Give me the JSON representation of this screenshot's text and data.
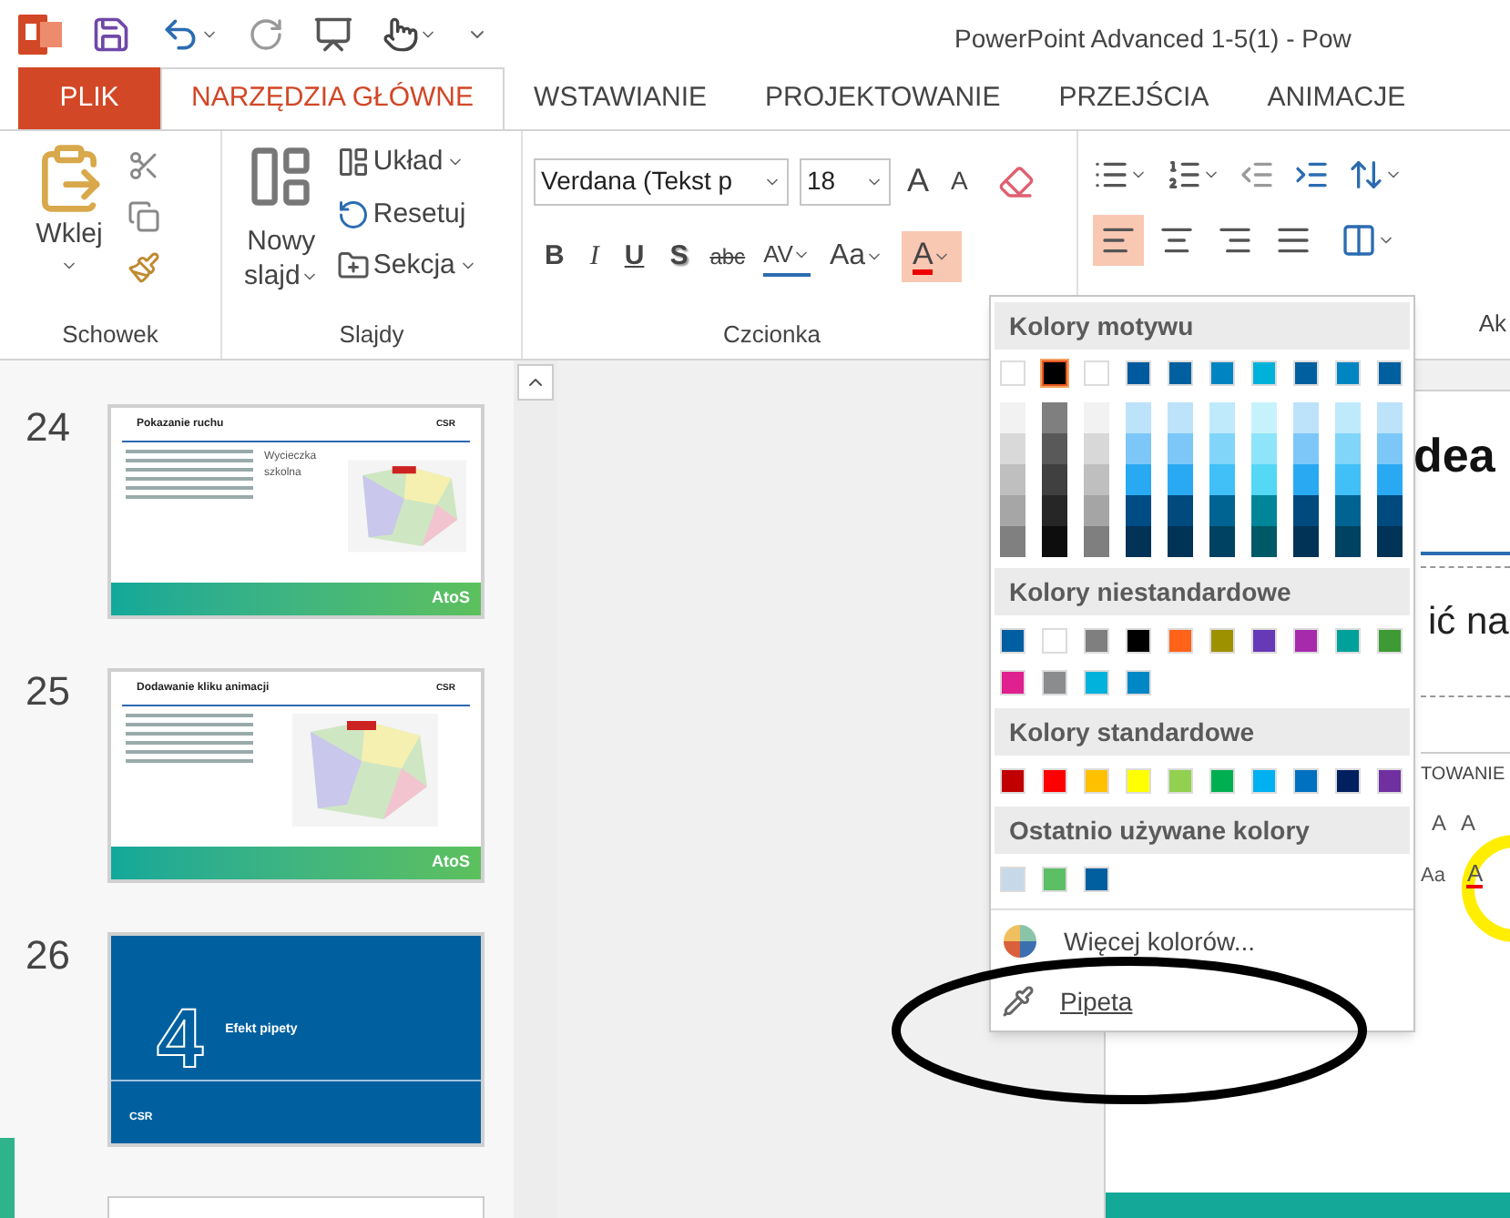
{
  "window": {
    "title": "PowerPoint Advanced 1-5(1) - Pow"
  },
  "tabs": [
    {
      "label": "PLIK",
      "kind": "file",
      "selected": false
    },
    {
      "label": "NARZĘDZIA GŁÓWNE",
      "kind": "tab",
      "selected": true
    },
    {
      "label": "WSTAWIANIE",
      "kind": "tab",
      "selected": false
    },
    {
      "label": "PROJEKTOWANIE",
      "kind": "tab",
      "selected": false
    },
    {
      "label": "PRZEJŚCIA",
      "kind": "tab",
      "selected": false
    },
    {
      "label": "ANIMACJE",
      "kind": "tab",
      "selected": false
    }
  ],
  "ribbon": {
    "clipboard": {
      "paste": "Wklej",
      "group": "Schowek"
    },
    "slides": {
      "new_slide": [
        "Nowy",
        "slajd"
      ],
      "layout": "Układ",
      "reset": "Resetuj",
      "section": "Sekcja",
      "group": "Slajdy"
    },
    "font": {
      "name": "Verdana (Tekst p",
      "size": "18",
      "grow": "A",
      "shrink": "A",
      "bold": "B",
      "italic": "I",
      "underline": "U",
      "shadow": "S",
      "strike": "abc",
      "spacing": "AV",
      "case": "Aa",
      "color_button": {
        "label": "A",
        "selected": true
      },
      "group": "Czcionka"
    },
    "paragraph": {
      "align": [
        {
          "kind": "left",
          "selected": true
        },
        {
          "kind": "center",
          "selected": false
        },
        {
          "kind": "right",
          "selected": false
        },
        {
          "kind": "justify",
          "selected": false
        }
      ]
    },
    "next_group": "Ak"
  },
  "slides": [
    {
      "number": "24",
      "kind": "content",
      "title": "Pokazanie ruchu",
      "side_title": "Wycieczka szkolna",
      "brand": "CSR",
      "footer": "AtoS"
    },
    {
      "number": "25",
      "kind": "content",
      "title": "Dodawanie kliku animacji",
      "brand": "CSR",
      "footer": "AtoS"
    },
    {
      "number": "26",
      "kind": "section",
      "big": "4",
      "title": "Efekt pipety",
      "brand": "CSR"
    },
    {
      "kind": "partial"
    }
  ],
  "editor": {
    "title": "dea",
    "body": "ić na",
    "inner_tab": "TOWANIE",
    "inner_buttons": [
      "A",
      "A",
      "Aa",
      "A"
    ]
  },
  "color_menu": {
    "sections": [
      {
        "title": "Kolory motywu",
        "kind": "theme",
        "top": [
          {
            "color": "#ffffff",
            "selected": false
          },
          {
            "color": "#000000",
            "selected": true
          },
          {
            "color": "#ffffff",
            "selected": false
          },
          {
            "color": "#005a9e",
            "selected": false
          },
          {
            "color": "#00609f",
            "selected": false
          },
          {
            "color": "#0085c3",
            "selected": false
          },
          {
            "color": "#00b2d9",
            "selected": false
          },
          {
            "color": "#00609f",
            "selected": false
          },
          {
            "color": "#0085c3",
            "selected": false
          },
          {
            "color": "#00609f",
            "selected": false
          }
        ],
        "shades": [
          {
            "colors": [
              {
                "color": "#f2f2f2"
              },
              {
                "color": "#d9d9d9"
              },
              {
                "color": "#bfbfbf"
              },
              {
                "color": "#a6a6a6"
              },
              {
                "color": "#808080"
              }
            ]
          },
          {
            "colors": [
              {
                "color": "#7f7f7f"
              },
              {
                "color": "#595959"
              },
              {
                "color": "#404040"
              },
              {
                "color": "#262626"
              },
              {
                "color": "#0d0d0d"
              }
            ]
          },
          {
            "colors": [
              {
                "color": "#f2f2f2"
              },
              {
                "color": "#d8d8d8"
              },
              {
                "color": "#bfbfbf"
              },
              {
                "color": "#a5a5a5"
              },
              {
                "color": "#7f7f7f"
              }
            ]
          },
          {
            "colors": [
              {
                "color": "#bde3fb"
              },
              {
                "color": "#7cc7f7"
              },
              {
                "color": "#2aa9f3"
              },
              {
                "color": "#004d85"
              },
              {
                "color": "#003356"
              }
            ]
          },
          {
            "colors": [
              {
                "color": "#bde3fb"
              },
              {
                "color": "#7cc7f7"
              },
              {
                "color": "#2aa9f3"
              },
              {
                "color": "#004a7d"
              },
              {
                "color": "#003356"
              }
            ]
          },
          {
            "colors": [
              {
                "color": "#bfeafc"
              },
              {
                "color": "#80d5f9"
              },
              {
                "color": "#40c0f6"
              },
              {
                "color": "#006492"
              },
              {
                "color": "#004261"
              }
            ]
          },
          {
            "colors": [
              {
                "color": "#c6f2fc"
              },
              {
                "color": "#8ee4f9"
              },
              {
                "color": "#55d7f6"
              },
              {
                "color": "#008599"
              },
              {
                "color": "#005966"
              }
            ]
          },
          {
            "colors": [
              {
                "color": "#bde3fb"
              },
              {
                "color": "#7cc7f7"
              },
              {
                "color": "#2aa9f3"
              },
              {
                "color": "#004a7d"
              },
              {
                "color": "#003356"
              }
            ]
          },
          {
            "colors": [
              {
                "color": "#bfeafc"
              },
              {
                "color": "#80d5f9"
              },
              {
                "color": "#40c0f6"
              },
              {
                "color": "#006492"
              },
              {
                "color": "#004261"
              }
            ]
          },
          {
            "colors": [
              {
                "color": "#bde3fb"
              },
              {
                "color": "#7cc7f7"
              },
              {
                "color": "#2aa9f3"
              },
              {
                "color": "#004a7d"
              },
              {
                "color": "#003356"
              }
            ]
          }
        ]
      },
      {
        "title": "Kolory niestandardowe",
        "kind": "flat",
        "colors": [
          {
            "color": "#005ea2"
          },
          {
            "color": "#ffffff"
          },
          {
            "color": "#7f7f7f"
          },
          {
            "color": "#000000"
          },
          {
            "color": "#ff6319"
          },
          {
            "color": "#9e9100"
          },
          {
            "color": "#6639b7"
          },
          {
            "color": "#a72aac"
          },
          {
            "color": "#00a19a"
          },
          {
            "color": "#3e9a34"
          },
          {
            "color": "#e0208f"
          },
          {
            "color": "#8a8c8e"
          },
          {
            "color": "#00b2dc"
          },
          {
            "color": "#0087c6"
          }
        ]
      },
      {
        "title": "Kolory standardowe",
        "kind": "flat",
        "colors": [
          {
            "color": "#c00000"
          },
          {
            "color": "#ff0000"
          },
          {
            "color": "#ffc000"
          },
          {
            "color": "#ffff00"
          },
          {
            "color": "#92d050"
          },
          {
            "color": "#00b050"
          },
          {
            "color": "#00b0f0"
          },
          {
            "color": "#0070c0"
          },
          {
            "color": "#002060"
          },
          {
            "color": "#7030a0"
          }
        ]
      },
      {
        "title": "Ostatnio używane kolory",
        "kind": "flat",
        "colors": [
          {
            "color": "#c5d9e8"
          },
          {
            "color": "#5cbf66"
          },
          {
            "color": "#00609f"
          }
        ]
      }
    ],
    "more": "Więcej kolorów...",
    "eyedropper": "Pipeta"
  }
}
